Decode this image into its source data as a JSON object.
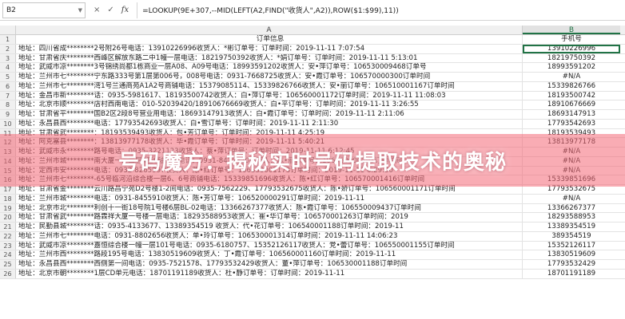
{
  "formula_bar": {
    "cell_ref": "B2",
    "cancel_icon": "×",
    "confirm_icon": "✓",
    "fx_label": "fx",
    "formula": "=LOOKUP(9E+307,--MID(LEFT(A2,FIND(\"收货人\",A2)),ROW($1:$99),11))"
  },
  "columns": {
    "a": "A",
    "b": "B"
  },
  "header_row": {
    "num": "1",
    "a": "订单信息",
    "b": "手机号"
  },
  "rows": [
    {
      "num": "2",
      "a": "地址：四川省成********2号附26号电话：13910226996收货人：*彬订单号：订单时间：2019-11-11 7:07:54",
      "b": "13910226996"
    },
    {
      "num": "3",
      "a": "地址：甘肃省庆********西峰区解放东路二中1幢一层电话：18219750392收货人：*娟订单号：订单时间：2019-11-11 5:13:01",
      "b": "18219750392"
    },
    {
      "num": "4",
      "a": "地址：武威市凉********3号锦绣尚都1栋商业一层A08、A09号电话：18993591202收货人：安•萍订单号：106530009468订单号",
      "b": "18993591202"
    },
    {
      "num": "5",
      "a": "地址：兰州市七********宁东路333号第1层第006号，008号电话：0931-7668725收货人：安•霞订单号：106570000300订单时间",
      "b": "#N/A"
    },
    {
      "num": "6",
      "a": "地址：兰州市七********湾1号兰通商苑A1A2号商铺电话：15379085114、15339826766收货人：安•丽订单号：106510001167订单时间",
      "b": "15339826766"
    },
    {
      "num": "7",
      "a": "地址：金昌市新********话：0935-5981617、18193500742收货人：白•萍订单号：106560001172订单时间：2019-11-11 11:08:03",
      "b": "18193500742"
    },
    {
      "num": "8",
      "a": "地址：北京市顺********店村西南电话：010-52039420/18910676669收货人：白•平订单号：订单时间：2019-11-11 3:26:55",
      "b": "18910676669"
    },
    {
      "num": "9",
      "a": "地址：甘肃省平********国B2区2段8号营业用电话：18693147913收货人：白•霞订单号：订单时间：2019-11-11 2:11:06",
      "b": "18693147913"
    },
    {
      "num": "10",
      "a": "地址：永昌县西********电话：17793542693收货人：白•雪订单号：订单时间：2019-11-11 2:11:30",
      "b": "17793542693"
    },
    {
      "num": "11",
      "a": "地址：甘肃省武********：18193539493收货人：包•芳订单号：订单时间：2019-11-11 4:25:19",
      "b": "18193539493"
    },
    {
      "num": "12",
      "a": "地址：阿克塞县********：13813977178收货人：毕•霞订单号：订单时间：2019-11-11 5:40:21",
      "b": "13813977178"
    },
    {
      "num": "13",
      "a": "地址：武威市永********路号电话：0935-3221123收货人：蔡•萍订单号：订单时间：2019-11-11 6:12:45",
      "b": "#N/A"
    },
    {
      "num": "14",
      "a": "地址：兰州市城********南大厦一、二层4至6轴线号电话：0931-8427820收货人：陈•丽订单号：106560000293订单时间",
      "b": "#N/A"
    },
    {
      "num": "15",
      "a": "地址：定西市安********电话：0932-8265997收货人：陈•红订单号：106530001173订单时间：2019-11-11 6:29:50",
      "b": "#N/A"
    },
    {
      "num": "16",
      "a": "地址：兰州市七********-65号临河沿综合楼一层6、6号商铺电话：15339851696收货人：陈•红订单号：106570001416订单时间",
      "b": "15339851696"
    },
    {
      "num": "17",
      "a": "地址：甘肃省金********云川路昌宁苑D2号楼1-2间电话：0935-7562229、17793532675收货人：陈•娇订单号：106560001171订单时间",
      "b": "17793532675"
    },
    {
      "num": "18",
      "a": "地址：兰州市城********电话：0931-8455910收货人：陈•芳订单号：106520000291订单时间：2019-11-11 ",
      "b": "#N/A"
    },
    {
      "num": "19",
      "a": "地址：北京市北********利创十一街18号院1号楼6层BL-02电话：13366267377收货人：陈•霞订单号：106550009437订单时间",
      "b": "13366267377"
    },
    {
      "num": "20",
      "a": "地址：甘肃省武********路霖祥大厦一号楼一层电话：18293588953收货人：崔•华订单号：106570001263订单时间：2019",
      "b": "18293588953"
    },
    {
      "num": "21",
      "a": "地址：民勤县城********话：0935-4133677、13389354519 收货人：代•花订单号：106540001188订单时间：2019-11",
      "b": "13389354519"
    },
    {
      "num": "22",
      "a": "地址：兰州市七********电话：0931-8802656收货人：单•玲订单号：106530001314订单时间：2019-11-11 14:06:23",
      "b": "389354519"
    },
    {
      "num": "23",
      "a": "地址：武威市凉********嘉恒综合楼一幢一层101号电话：0935-6180757、15352126117收货人：党•蕾订单号：106550001155订单时间",
      "b": "15352126117"
    },
    {
      "num": "24",
      "a": "地址：兰州市西********路段195号电话：13830519609收货人：丁•霞订单号：106560001160订单时间：2019-11-11",
      "b": "13830519609"
    },
    {
      "num": "25",
      "a": "地址：永昌县西********西侧第一间电话：0935-7521578、17793532429收货人：董•萍订单号：106530001188订单时间",
      "b": "17793532429"
    },
    {
      "num": "26",
      "a": "地址：北京市朝********1层CD单元电话：18701191189收货人：杜•静订单号：订单时间：2019-11-11 ",
      "b": "18701191189"
    }
  ],
  "overlay": {
    "title": "号码魔方：揭秘实时号码提取技术的奥秘"
  }
}
